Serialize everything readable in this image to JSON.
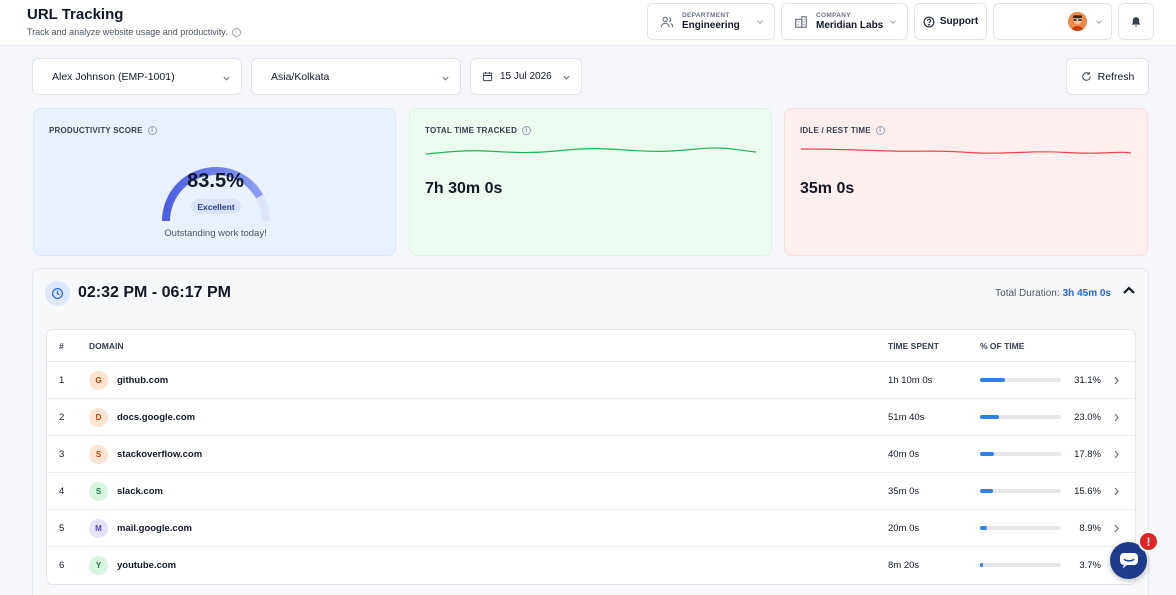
{
  "header": {
    "title": "URL Tracking",
    "subtitle": "Track and analyze website usage and productivity.",
    "department": {
      "label": "DEPARTMENT",
      "value": "Engineering"
    },
    "company": {
      "label": "COMPANY",
      "value": "Meridian Labs"
    },
    "support_label": "Support"
  },
  "filters": {
    "employee": "Alex Johnson (EMP-1001)",
    "timezone": "Asia/Kolkata",
    "date": "15 Jul 2026",
    "refresh_label": "Refresh"
  },
  "cards": {
    "productivity": {
      "title": "PRODUCTIVITY SCORE",
      "score": "83.5%",
      "score_value": 83.5,
      "rating": "Excellent",
      "message": "Outstanding work today!"
    },
    "total_time": {
      "title": "TOTAL TIME TRACKED",
      "value": "7h 30m 0s"
    },
    "idle": {
      "title": "IDLE / REST TIME",
      "value": "35m 0s"
    }
  },
  "session": {
    "range": "02:32 PM - 06:17 PM",
    "total_label": "Total Duration:",
    "total_value": "3h 45m 0s",
    "columns": {
      "num": "#",
      "domain": "DOMAIN",
      "time": "TIME SPENT",
      "pct": "% OF TIME"
    },
    "rows": [
      {
        "num": "1",
        "initial": "G",
        "domain": "github.com",
        "time": "1h 10m 0s",
        "pct": "31.1%",
        "pct_value": 31.1,
        "badge_bg": "#fde4d2",
        "badge_fg": "#c2410c"
      },
      {
        "num": "2",
        "initial": "D",
        "domain": "docs.google.com",
        "time": "51m 40s",
        "pct": "23.0%",
        "pct_value": 23.0,
        "badge_bg": "#fde4d2",
        "badge_fg": "#c2410c"
      },
      {
        "num": "3",
        "initial": "S",
        "domain": "stackoverflow.com",
        "time": "40m 0s",
        "pct": "17.8%",
        "pct_value": 17.8,
        "badge_bg": "#fde4d2",
        "badge_fg": "#c2410c"
      },
      {
        "num": "4",
        "initial": "S",
        "domain": "slack.com",
        "time": "35m 0s",
        "pct": "15.6%",
        "pct_value": 15.6,
        "badge_bg": "#d9f5e0",
        "badge_fg": "#15803d"
      },
      {
        "num": "5",
        "initial": "M",
        "domain": "mail.google.com",
        "time": "20m 0s",
        "pct": "8.9%",
        "pct_value": 8.9,
        "badge_bg": "#e5e2fb",
        "badge_fg": "#5b4bc4"
      },
      {
        "num": "6",
        "initial": "Y",
        "domain": "youtube.com",
        "time": "8m 20s",
        "pct": "3.7%",
        "pct_value": 3.7,
        "badge_bg": "#d9f5e0",
        "badge_fg": "#15803d"
      }
    ]
  },
  "chat": {
    "alert": "!"
  },
  "colors": {
    "accent": "#2563eb",
    "total_line": "#22b55a",
    "idle_line": "#e5484d",
    "gauge": "#5b6ee8"
  }
}
